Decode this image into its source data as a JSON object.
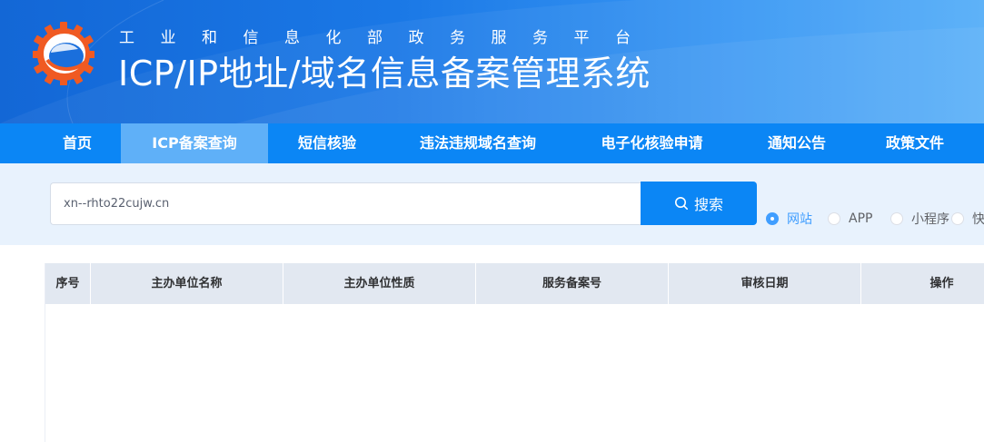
{
  "header": {
    "org_name": "工业和信息化部政务服务平台",
    "system_title": "ICP/IP地址/域名信息备案管理系统"
  },
  "nav": {
    "items": [
      {
        "label": "首页",
        "active": false
      },
      {
        "label": "ICP备案查询",
        "active": true
      },
      {
        "label": "短信核验",
        "active": false
      },
      {
        "label": "违法违规域名查询",
        "active": false
      },
      {
        "label": "电子化核验申请",
        "active": false
      },
      {
        "label": "通知公告",
        "active": false
      },
      {
        "label": "政策文件",
        "active": false
      }
    ]
  },
  "search": {
    "value": "xn--rhto22cujw.cn",
    "button_label": "搜索",
    "types": [
      {
        "label": "网站",
        "checked": true
      },
      {
        "label": "APP",
        "checked": false
      },
      {
        "label": "小程序",
        "checked": false
      },
      {
        "label": "快",
        "checked": false
      }
    ]
  },
  "table": {
    "columns": [
      "序号",
      "主办单位名称",
      "主办单位性质",
      "服务备案号",
      "审核日期",
      "操作"
    ]
  },
  "colors": {
    "nav_bg": "#0b86f5",
    "nav_active": "#5fb0f8",
    "search_band": "#e8f2fd",
    "accent": "#409eff",
    "logo_orange": "#f05a22"
  }
}
